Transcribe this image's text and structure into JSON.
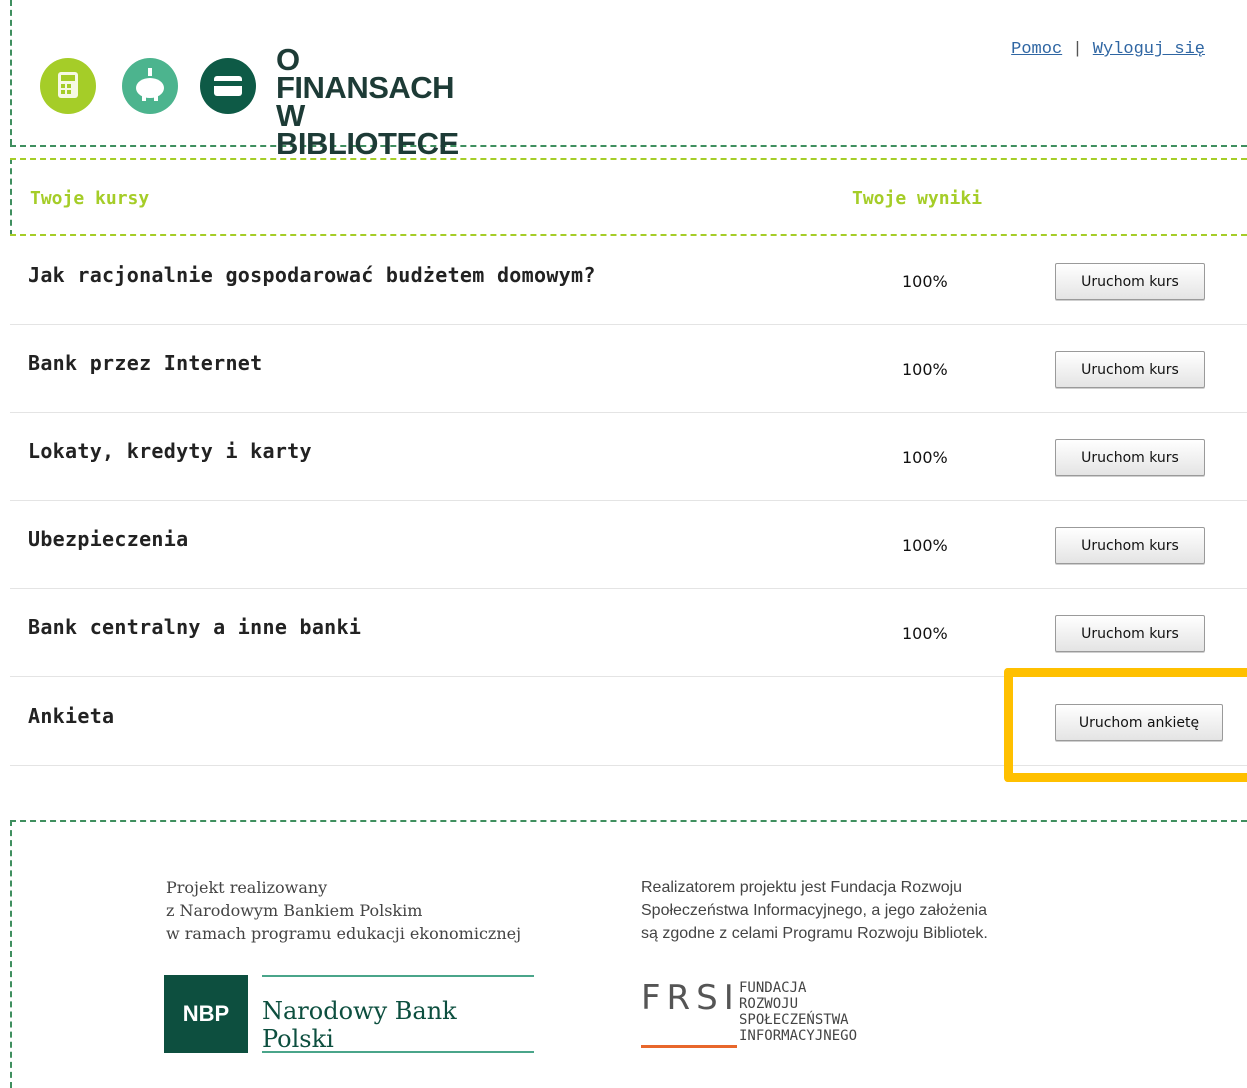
{
  "header": {
    "logo_text": "O FINANSACH\nW BIBLIOTECE",
    "links": {
      "help": "Pomoc",
      "separator": "|",
      "logout": "Wyloguj się"
    }
  },
  "table": {
    "col_courses": "Twoje kursy",
    "col_results": "Twoje wyniki",
    "rows": [
      {
        "title": "Jak racjonalnie gospodarować budżetem domowym?",
        "score": "100%",
        "button": "Uruchom kurs"
      },
      {
        "title": "Bank przez Internet",
        "score": "100%",
        "button": "Uruchom kurs"
      },
      {
        "title": "Lokaty, kredyty i karty",
        "score": "100%",
        "button": "Uruchom kurs"
      },
      {
        "title": "Ubezpieczenia",
        "score": "100%",
        "button": "Uruchom kurs"
      },
      {
        "title": "Bank centralny a inne banki",
        "score": "100%",
        "button": "Uruchom kurs"
      },
      {
        "title": "Ankieta",
        "score": "",
        "button": "Uruchom ankietę"
      }
    ]
  },
  "footer": {
    "left_text": "Projekt realizowany\nz Narodowym Bankiem Polskim\nw ramach programu edukacji ekonomicznej",
    "right_text": "Realizatorem projektu jest Fundacja Rozwoju\nSpołeczeństwa Informacyjnego, a jego założenia\nsą zgodne z celami Programu Rozwoju Bibliotek.",
    "nbp_short": "NBP",
    "nbp_name": "Narodowy Bank Polski",
    "frsi_short": "FRSI",
    "frsi_full": "FUNDACJA\nROZWOJU\nSPOŁECZEŃSTWA\nINFORMACYJNEGO"
  },
  "colors": {
    "accent_green": "#a5cd28",
    "dark_green": "#0d4f3f",
    "highlight": "#ffc000",
    "link": "#2f66a3"
  },
  "icons": [
    "calculator-icon",
    "piggy-bank-icon",
    "card-icon"
  ]
}
